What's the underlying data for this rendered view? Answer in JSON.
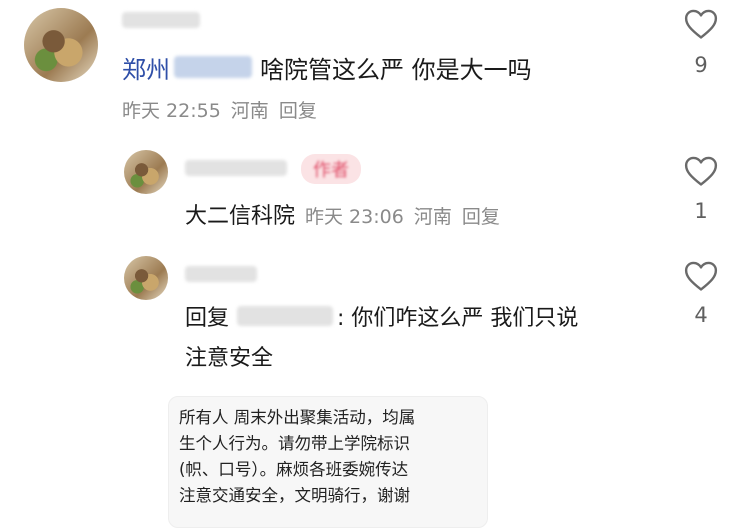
{
  "comments": [
    {
      "username_redacted": true,
      "location_prefix": "郑州",
      "text": "啥院管这么严 你是大一吗",
      "time": "昨天 22:55",
      "region": "河南",
      "reply_label": "回复",
      "likes": "9"
    },
    {
      "username_redacted": true,
      "author_badge": "作者",
      "text": "大二信科院",
      "time": "昨天 23:06",
      "region": "河南",
      "reply_label": "回复",
      "likes": "1"
    },
    {
      "username_redacted": true,
      "reply_prefix": "回复",
      "text_line1": ": 你们咋这么严 我们只说",
      "text_line2": "注意安全",
      "likes": "4"
    }
  ],
  "attachment": {
    "lines": [
      "所有人 周末外出聚集活动，均属",
      "生个人行为。请勿带上学院标识",
      "(帜、口号）。麻烦各班委婉传达",
      "注意交通安全，文明骑行，谢谢"
    ]
  },
  "icons": {
    "like": "heart-outline-icon"
  },
  "colors": {
    "name_blue": "#2f4fa8",
    "meta_gray": "#8a8a8a",
    "badge_pink": "#e0506a"
  }
}
